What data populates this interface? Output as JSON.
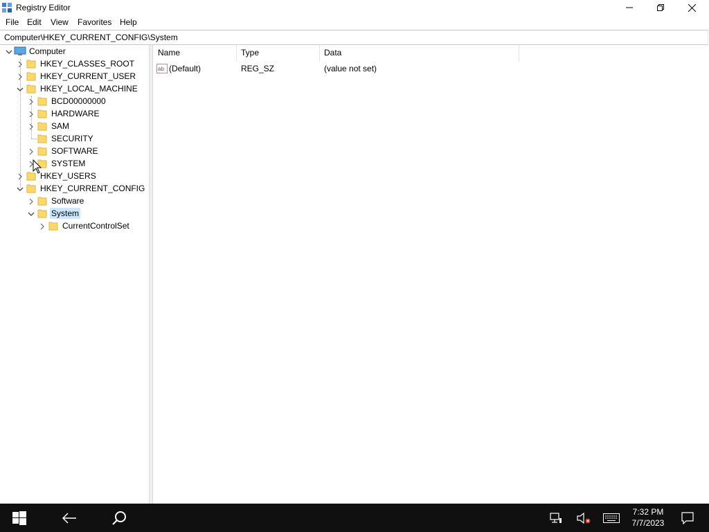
{
  "window": {
    "title": "Registry Editor",
    "icon": "registry-editor-icon"
  },
  "menu": [
    "File",
    "Edit",
    "View",
    "Favorites",
    "Help"
  ],
  "address": "Computer\\HKEY_CURRENT_CONFIG\\System",
  "tree": {
    "root": "Computer",
    "hkcr": "HKEY_CLASSES_ROOT",
    "hkcu": "HKEY_CURRENT_USER",
    "hklm": "HKEY_LOCAL_MACHINE",
    "hklm_children": [
      "BCD00000000",
      "HARDWARE",
      "SAM",
      "SECURITY",
      "SOFTWARE",
      "SYSTEM"
    ],
    "hku": "HKEY_USERS",
    "hkcc": "HKEY_CURRENT_CONFIG",
    "hkcc_children": [
      "Software",
      "System"
    ],
    "system_children": [
      "CurrentControlSet"
    ],
    "selected": "System"
  },
  "list": {
    "columns": [
      "Name",
      "Type",
      "Data"
    ],
    "rows": [
      {
        "name": "(Default)",
        "type": "REG_SZ",
        "data": "(value not set)",
        "icon": "string-value-icon"
      }
    ]
  },
  "taskbar": {
    "time": "7:32 PM",
    "date": "7/7/2023",
    "icons": [
      "start-icon",
      "back-icon",
      "search-icon",
      "network-icon",
      "volume-muted-icon",
      "keyboard-icon",
      "notification-icon"
    ]
  },
  "colors": {
    "selection": "#cce8ff",
    "taskbar": "#101010",
    "folder": "#ffd966"
  }
}
